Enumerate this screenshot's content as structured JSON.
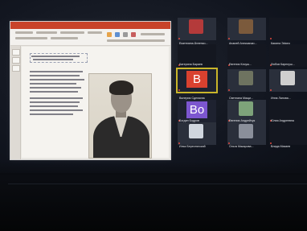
{
  "gallery": {
    "rows": [
      [
        {
          "name": "Екатерина Дуненко...",
          "tile": "photo",
          "thumb_color": "#b43a3a"
        },
        {
          "name": "Андрей Александр...",
          "tile": "photo",
          "thumb_color": "#7b5a3c"
        },
        {
          "name": "Карина Эфиго",
          "tile": "plain"
        }
      ],
      [
        {
          "name": "Катерина Бараев",
          "tile": "plain"
        },
        {
          "name": "Евгения Кочуш...",
          "tile": "plain"
        },
        {
          "name": "Любов Карелуш...",
          "tile": "plain"
        }
      ],
      [
        {
          "name": "Валерия Сделкина",
          "tile": "initial",
          "initial": "В",
          "color": "#d9412f",
          "active": true
        },
        {
          "name": "Светлана Мащи...",
          "tile": "photo",
          "thumb_color": "#6e7360"
        },
        {
          "name": "Инна Ланова...",
          "tile": "photo",
          "thumb_color": "#cfcfcf"
        }
      ],
      [
        {
          "name": "Богдан Бодров",
          "tile": "initial",
          "initial": "Bo",
          "color": "#7c56cf"
        },
        {
          "name": "Евгения Андрейчук",
          "tile": "photo",
          "thumb_color": "#7ea37a"
        },
        {
          "name": "Юлия Андреевна",
          "tile": "plain"
        }
      ],
      [
        {
          "name": "Илья Берестянский",
          "tile": "photo",
          "thumb_color": "#d0d6de"
        },
        {
          "name": "Ольга Макарова...",
          "tile": "photo",
          "thumb_color": "#8a8f9a"
        },
        {
          "name": "Влада Мазаев",
          "tile": "plain"
        }
      ]
    ]
  }
}
